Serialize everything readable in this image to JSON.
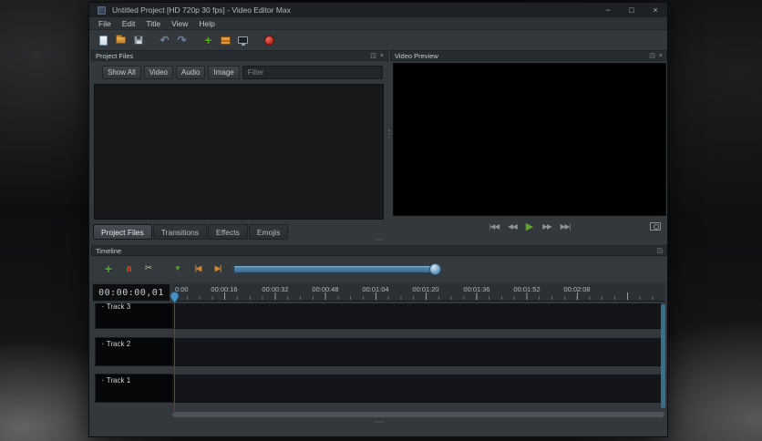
{
  "titlebar": {
    "title": "Untitled Project [HD 720p 30 fps] - Video Editor Max"
  },
  "menubar": [
    "File",
    "Edit",
    "Title",
    "View",
    "Help"
  ],
  "docks": {
    "project_files": "Project Files",
    "video_preview": "Video Preview",
    "timeline": "Timeline"
  },
  "project_files": {
    "tabs": [
      "Show All",
      "Video",
      "Audio",
      "Image"
    ],
    "filter_placeholder": "Filter",
    "bottom_tabs": [
      "Project Files",
      "Transitions",
      "Effects",
      "Emojis"
    ],
    "selected_tab": "Project Files"
  },
  "timeline": {
    "timecode": "00:00:00,01",
    "ruler_labels": [
      "0:00",
      "00:00:16",
      "00:00:32",
      "00:00:48",
      "00:01:04",
      "00:01:20",
      "00:01:36",
      "00:01:52",
      "00:02:08"
    ],
    "tracks": [
      "Track 3",
      "Track 2",
      "Track 1"
    ]
  },
  "icons": {
    "minimize": "−",
    "maximize": "□",
    "close": "×",
    "float": "◳",
    "dock_close": "×",
    "undo": "↶",
    "redo": "↷",
    "add": "+",
    "scissors": "✂",
    "marker": "▼",
    "prev_marker": "|◀",
    "next_marker": "▶|",
    "center_dots": "● ●",
    "jump_start": "|◀◀",
    "rewind": "◀◀",
    "play": "▶",
    "fast_forward": "▶▶",
    "jump_end": "▶▶|",
    "dots_h": "⋯",
    "dots_v": "⋮",
    "track_badge": "▪"
  },
  "colors": {
    "play_green": "#5fa32d",
    "record_red": "#b1271c",
    "accent_blue": "#4a8fc0",
    "playhead_red": "#9e2a33",
    "marker_orange": "#d8862a",
    "add_green": "#4fae22"
  }
}
